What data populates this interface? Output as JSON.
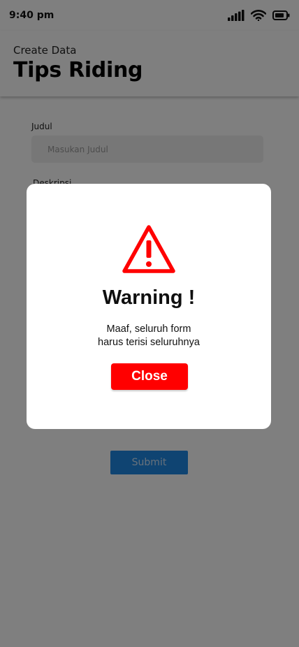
{
  "status_bar": {
    "time": "9:40 pm",
    "icons": [
      "signal-icon",
      "wifi-icon",
      "battery-icon"
    ]
  },
  "header": {
    "subtitle": "Create Data",
    "title": "Tips Riding"
  },
  "form": {
    "judul_label": "Judul",
    "judul_placeholder": "Masukan Judul",
    "deskripsi_label": "Deskripsi",
    "submit_label": "Submit"
  },
  "dialog": {
    "icon": "warning-icon",
    "title": "Warning !",
    "message_line1": "Maaf, seluruh form",
    "message_line2": "harus terisi seluruhnya",
    "close_label": "Close"
  },
  "colors": {
    "warning_red": "#ff0000",
    "submit_blue": "#1e88e5",
    "overlay": "rgba(0,0,0,0.5)"
  }
}
